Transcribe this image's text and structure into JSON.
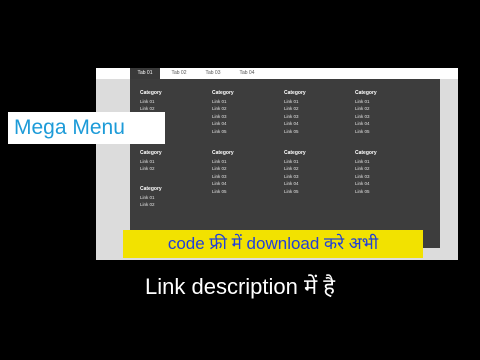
{
  "tabs": [
    {
      "label": "Tab 01",
      "active": true
    },
    {
      "label": "Tab 02",
      "active": false
    },
    {
      "label": "Tab 03",
      "active": false
    },
    {
      "label": "Tab 04",
      "active": false
    }
  ],
  "menu": {
    "columns": [
      {
        "groups": [
          {
            "category": "Category",
            "links": [
              "Link 01",
              "Link 02",
              "Link 03"
            ]
          },
          {
            "category": "Category",
            "links": [
              "Link 01",
              "Link 02"
            ]
          },
          {
            "category": "Category",
            "links": [
              "Link 01",
              "Link 02"
            ]
          }
        ]
      },
      {
        "groups": [
          {
            "category": "Category",
            "links": [
              "Link 01",
              "Link 02",
              "Link 03",
              "Link 04",
              "Link 05"
            ]
          },
          {
            "category": "Category",
            "links": [
              "Link 01",
              "Link 02",
              "Link 03",
              "Link 04",
              "Link 05"
            ]
          }
        ]
      },
      {
        "groups": [
          {
            "category": "Category",
            "links": [
              "Link 01",
              "Link 02",
              "Link 03",
              "Link 04",
              "Link 05"
            ]
          },
          {
            "category": "Category",
            "links": [
              "Link 01",
              "Link 02",
              "Link 03",
              "Link 04",
              "Link 05"
            ]
          }
        ]
      },
      {
        "groups": [
          {
            "category": "Category",
            "links": [
              "Link 01",
              "Link 02",
              "Link 03",
              "Link 04",
              "Link 05"
            ]
          },
          {
            "category": "Category",
            "links": [
              "Link 01",
              "Link 02",
              "Link 03",
              "Link 04",
              "Link 05"
            ]
          }
        ]
      }
    ]
  },
  "overlay": {
    "title": "Mega Menu",
    "banner": "code फ्री में download करे अभी",
    "description": "Link description में है"
  },
  "colors": {
    "accent": "#1d9bd8",
    "banner_bg": "#f2e200",
    "banner_text": "#2140d9",
    "panel_bg": "#3d3d3d"
  }
}
